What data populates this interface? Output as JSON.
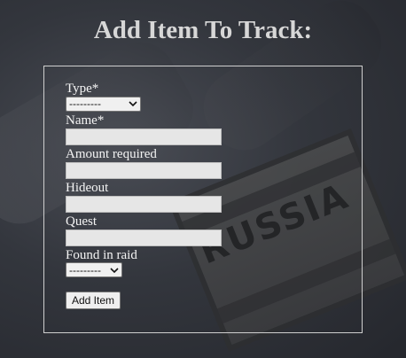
{
  "page": {
    "title": "Add Item To Track:"
  },
  "form": {
    "type_label": "Type*",
    "type_value": "---------",
    "name_label": "Name*",
    "name_value": "",
    "amount_label": "Amount required",
    "amount_value": "",
    "hideout_label": "Hideout",
    "hideout_value": "",
    "quest_label": "Quest",
    "quest_value": "",
    "fir_label": "Found in raid",
    "fir_value": "---------",
    "submit_label": "Add Item"
  },
  "background": {
    "patch_text": "RUSSIA"
  },
  "colors": {
    "background": "#33363d",
    "title": "#d7d7d7",
    "text": "#f4f4f4",
    "input_bg": "#e6e6e6",
    "border": "#cfcfcf"
  }
}
